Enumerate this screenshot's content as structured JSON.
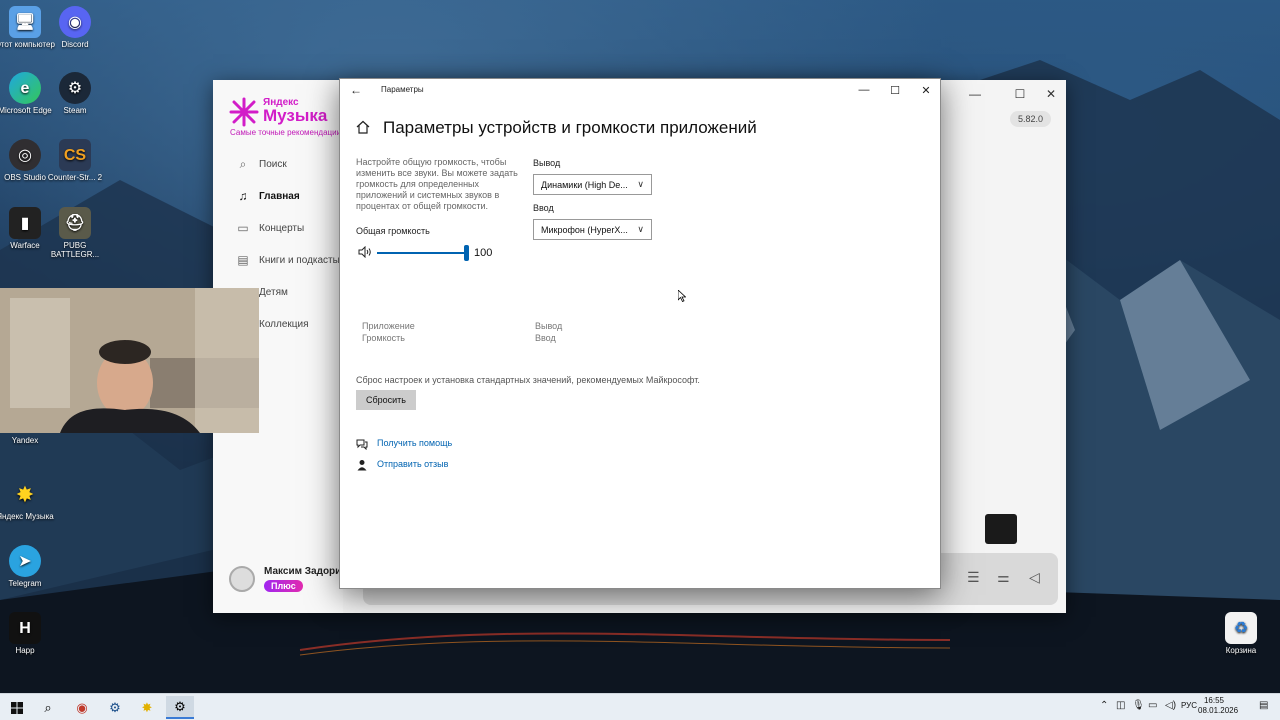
{
  "desktop": {
    "icons": [
      {
        "label": "Этот компьютер"
      },
      {
        "label": "Discord"
      },
      {
        "label": "Microsoft Edge"
      },
      {
        "label": "Steam"
      },
      {
        "label": "OBS Studio"
      },
      {
        "label": "Counter-Str... 2"
      },
      {
        "label": "Warface"
      },
      {
        "label": "PUBG BATTLEGR..."
      },
      {
        "label": "Yandex"
      },
      {
        "label": "Яндекс Музыка"
      },
      {
        "label": "Telegram"
      },
      {
        "label": "Happ"
      },
      {
        "label": "Корзина"
      }
    ]
  },
  "music_app": {
    "logo_top": "Яндекс",
    "logo_main": "Музыка",
    "tagline": "Самые точные рекомендации",
    "nav": [
      {
        "label": "Поиск",
        "icon": "search-icon"
      },
      {
        "label": "Главная",
        "icon": "music-note-icon"
      },
      {
        "label": "Концерты",
        "icon": "ticket-icon"
      },
      {
        "label": "Книги и подкасты",
        "icon": "book-icon"
      },
      {
        "label": "Детям",
        "icon": "kids-icon"
      },
      {
        "label": "Коллекция",
        "icon": "collection-icon"
      }
    ],
    "version": "5.82.0",
    "user_name": "Максим Задорин",
    "plus_badge": "Плюс"
  },
  "settings": {
    "window_title": "Параметры",
    "page_title": "Параметры устройств и громкости приложений",
    "description": "Настройте общую громкость, чтобы изменить все звуки. Вы можете задать громкость для определенных приложений и системных звуков в процентах от общей громкости.",
    "master_volume_label": "Общая громкость",
    "master_volume_value": "100",
    "master_volume_level": 1.0,
    "output_label": "Вывод",
    "output_value": "Динамики (High De...",
    "input_label": "Ввод",
    "input_value": "Микрофон (HyperX...",
    "col_app": "Приложение",
    "col_volume": "Громкость",
    "col_output": "Вывод",
    "col_input": "Ввод",
    "reset_description": "Сброс настроек и установка стандартных значений, рекомендуемых Майкрософт.",
    "reset_button": "Сбросить",
    "help_link": "Получить помощь",
    "feedback_link": "Отправить отзыв"
  },
  "taskbar": {
    "language": "РУС",
    "time": "16:55",
    "date": "08.01.2026"
  },
  "colors": {
    "accent": "#0063b1",
    "music_brand": "#d21dc8"
  }
}
